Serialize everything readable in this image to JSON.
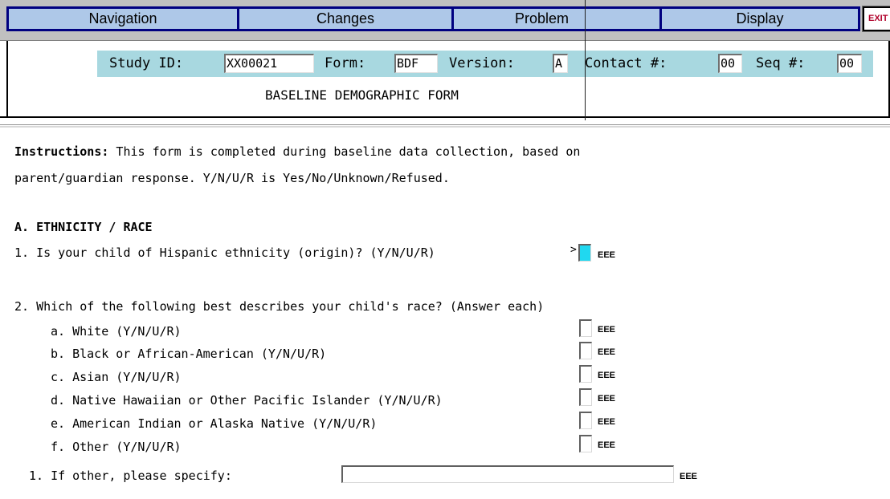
{
  "menu": {
    "navigation": "Navigation",
    "changes": "Changes",
    "problem": "Problem",
    "display": "Display",
    "exit": "EXIT"
  },
  "header": {
    "study_id_label": "Study ID:",
    "study_id_value": "XX00021",
    "form_label": "Form:",
    "form_value": "BDF",
    "version_label": "Version:",
    "version_value": "A",
    "contact_label": "Contact #:",
    "contact_value": "00",
    "seq_label": "Seq #:",
    "seq_value": "00",
    "form_title": "BASELINE DEMOGRAPHIC FORM"
  },
  "instructions": {
    "label": "Instructions:",
    "line1": " This form is completed during baseline data collection, based on",
    "line2": "parent/guardian response. Y/N/U/R is Yes/No/Unknown/Refused."
  },
  "section_a": {
    "heading": "A. ETHNICITY / RACE",
    "q1": {
      "text": "1. Is your child of Hispanic ethnicity (origin)? (Y/N/U/R)",
      "marker": ">",
      "code": "EEE",
      "value": ""
    },
    "q2": {
      "text": "2. Which of the following best describes your child's race? (Answer each)",
      "items": [
        {
          "label": "a. White (Y/N/U/R)",
          "code": "EEE",
          "value": ""
        },
        {
          "label": "b. Black or African-American (Y/N/U/R)",
          "code": "EEE",
          "value": ""
        },
        {
          "label": "c. Asian (Y/N/U/R)",
          "code": "EEE",
          "value": ""
        },
        {
          "label": "d. Native Hawaiian or Other Pacific Islander (Y/N/U/R)",
          "code": "EEE",
          "value": ""
        },
        {
          "label": "e. American Indian or Alaska Native (Y/N/U/R)",
          "code": "EEE",
          "value": ""
        },
        {
          "label": "f. Other (Y/N/U/R)",
          "code": "EEE",
          "value": ""
        }
      ],
      "other_specify": {
        "label": "1. If other, please specify:",
        "code": "EEE",
        "value": ""
      }
    }
  },
  "colors": {
    "menu_bg": "#c0c0c0",
    "menu_button": "#aec8e8",
    "menu_border": "#000080",
    "id_strip": "#a8d8e0",
    "active_field": "#20d8f0",
    "exit_text": "#b0002a"
  }
}
